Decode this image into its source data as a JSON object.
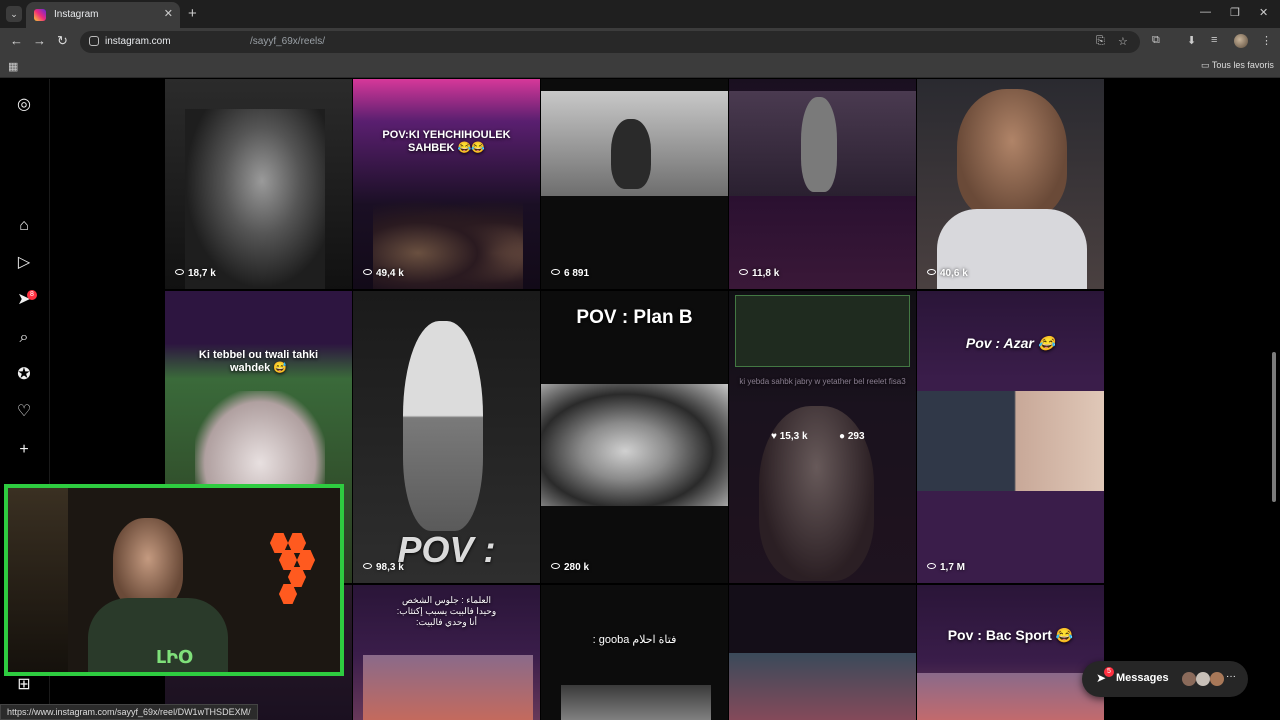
{
  "browser": {
    "tab_title": "Instagram",
    "url_host": "instagram.com",
    "url_path": "/sayyf_69x/reels/",
    "bookmark_folder": "Tous les favoris",
    "status_url": "https://www.instagram.com/sayyf_69x/reel/DW1wTHSDEXM/"
  },
  "sidebar": {
    "notification_badge": "8"
  },
  "reels": [
    {
      "views": "18,7 k",
      "caption": ""
    },
    {
      "views": "49,4 k",
      "caption": "POV:KI YEHCHIHOULEK SAHBEK 😂😂"
    },
    {
      "views": "6 891",
      "caption": ""
    },
    {
      "views": "11,8 k",
      "caption": ""
    },
    {
      "views": "40,6 k",
      "caption": ""
    },
    {
      "views": "",
      "caption": "Ki tebbel ou twali tahki wahdek 😅"
    },
    {
      "views": "98,3 k",
      "caption": "POV :"
    },
    {
      "views": "280 k",
      "caption": "POV : Plan B"
    },
    {
      "views": "",
      "caption": "ki yebda sahbk jabry w yetather bel reelet fisa3",
      "likes": "15,3 k",
      "comments": "293"
    },
    {
      "views": "1,7 M",
      "caption": "Pov : Azar 😂"
    },
    {
      "views": "",
      "caption": "العلماء : جلوس الشخص وحيدا فالبيت يسبب إكتئاب: أنا وحدي فالبيت:"
    },
    {
      "views": "",
      "caption": "فتاة احلام gooba :"
    },
    {
      "views": "",
      "caption": ""
    },
    {
      "views": "",
      "caption": "Pov : Bac Sport 😂"
    }
  ],
  "messages": {
    "label": "Messages",
    "badge": "5"
  },
  "colors": {
    "accent_green": "#2ecc40",
    "badge_red": "#ff3040",
    "tile_purple": "#3a1d4a"
  }
}
